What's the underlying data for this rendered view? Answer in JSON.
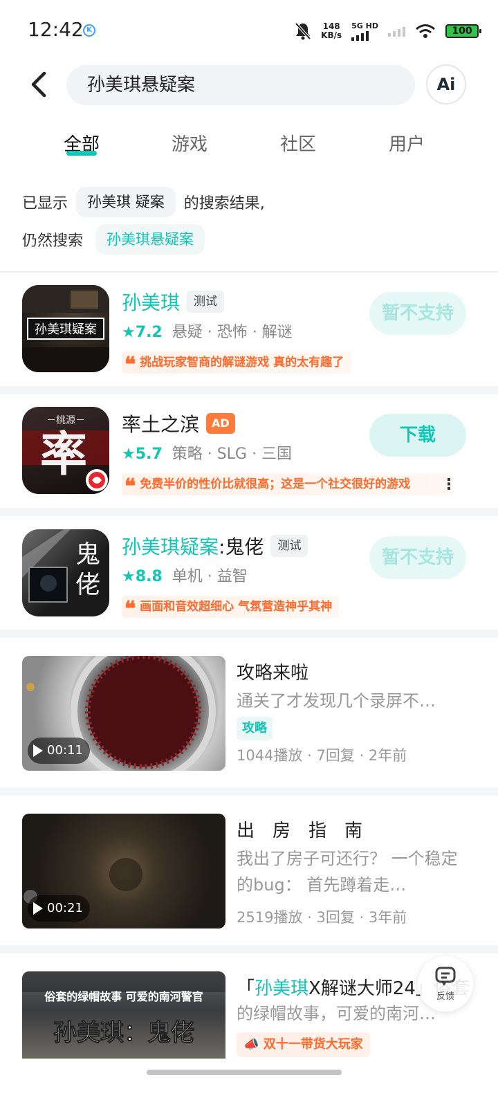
{
  "status_bar": {
    "time": "12:42",
    "net_speed_value": "148",
    "net_speed_unit": "KB/s",
    "network": "5G HD",
    "battery": "100"
  },
  "search": {
    "query": "孙美琪悬疑案",
    "ai_label": "Ai"
  },
  "tabs": [
    {
      "label": "全部",
      "active": true
    },
    {
      "label": "游戏",
      "active": false
    },
    {
      "label": "社区",
      "active": false
    },
    {
      "label": "用户",
      "active": false
    }
  ],
  "shown": {
    "prefix": "已显示",
    "corrected_term": "孙美琪 疑案",
    "suffix": "的搜索结果,",
    "still_label": "仍然搜索",
    "original_term": "孙美琪悬疑案"
  },
  "games": [
    {
      "name_highlight": "孙美琪",
      "name_rest": "",
      "tag": "测试",
      "rating": "7.2",
      "categories": "悬疑 · 恐怖 · 解谜",
      "review": "挑战玩家智商的解谜游戏 真的太有趣了",
      "button": "暂不支持",
      "icon_text": "孙美琪疑案"
    },
    {
      "name_highlight": "",
      "name_rest": "率土之滨",
      "tag": "AD",
      "rating": "5.7",
      "categories": "策略 · SLG · 三国",
      "review": "免费半价的性价比就很高；这是一个社交很好的游戏",
      "button": "下载",
      "icon_text": "率",
      "icon_sub": "－桃源－"
    },
    {
      "name_highlight": "孙美琪疑案",
      "name_rest": ":鬼佬",
      "tag": "测试",
      "rating": "8.8",
      "categories": "单机 · 益智",
      "review": "画面和音效超细心 气氛营造神乎其神",
      "button": "暂不支持",
      "icon_text": "鬼佬"
    }
  ],
  "videos": [
    {
      "duration": "00:11",
      "title": "攻略来啦",
      "desc": "通关了才发现几个录屏不…",
      "tag": "攻略",
      "stats": "1044播放 · 7回复 · 2年前"
    },
    {
      "duration": "00:21",
      "title": "出　房　指　南",
      "desc": "我出了房子可还行？ 一个稳定的bug： 首先蹲着走…",
      "stats": "2519播放 · 3回复 · 3年前"
    },
    {
      "title_open": "「",
      "title_highlight": "孙美琪",
      "title_rest": "X解谜大师24」俗套",
      "desc": "的绿帽故事，可爱的南河…",
      "promo": "双十一带货大玩家",
      "thumb_top": "俗套的绿帽故事 可爱的南河警官",
      "thumb_big": "孙美琪：鬼佬"
    }
  ],
  "feedback_label": "反馈",
  "colors": {
    "accent": "#14c5b5",
    "review": "#ff6a2e",
    "ad": "#ff7a3d"
  }
}
